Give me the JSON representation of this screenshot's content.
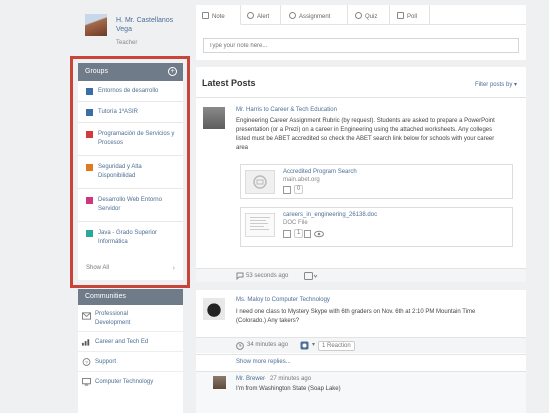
{
  "profile": {
    "name_line1": "H. Mr. Castellanos",
    "name_line2": "Vega",
    "role": "Teacher"
  },
  "groups": {
    "title": "Groups",
    "items": [
      {
        "label_1": "Entornos de desarrollo",
        "label_2": "",
        "color": "#3a6ea5"
      },
      {
        "label_1": "Tutoría 1ºASIR",
        "label_2": "",
        "color": "#3a6ea5"
      },
      {
        "label_1": "Programación de Servicios y",
        "label_2": "Procesos",
        "color": "#d23b3b"
      },
      {
        "label_1": "Seguridad y Alta",
        "label_2": "Disponibilidad",
        "color": "#e07a1e"
      },
      {
        "label_1": "Desarrollo Web Entorno",
        "label_2": "Servidor",
        "color": "#d0367a"
      },
      {
        "label_1": "Java - Grado Superior",
        "label_2": "Informática",
        "color": "#2aa89a"
      }
    ],
    "show_all": "Show All"
  },
  "communities": {
    "title": "Communities",
    "items": [
      {
        "label_1": "Professional",
        "label_2": "Development",
        "icon": "envelope-icon"
      },
      {
        "label_1": "Career and Tech Ed",
        "label_2": "",
        "icon": "bar-chart-icon"
      },
      {
        "label_1": "Support",
        "label_2": "",
        "icon": "help-icon"
      },
      {
        "label_1": "Computer Technology",
        "label_2": "",
        "icon": "monitor-icon"
      }
    ]
  },
  "composer": {
    "tabs": [
      "Note",
      "Alert",
      "Assignment",
      "Quiz",
      "Poll"
    ],
    "placeholder": "Type your note here..."
  },
  "feed": {
    "title": "Latest Posts",
    "filter": "Filter posts by ▾",
    "post1": {
      "author": "Mr. Harris to Career & Tech Education",
      "body": [
        "Engineering Career Assignment Rubric (by request). Students are asked to prepare a PowerPoint",
        "presentation (or a Prezi) on a career in Engineering using the attached worksheets. Any colleges",
        "listed must be ABET accredited so check the ABET search link below for schools with your career",
        "area"
      ],
      "link_title": "Accredited Program Search",
      "link_url": "main.abet.org",
      "link_count": "0",
      "file_name": "careers_in_engineering_26138.doc",
      "file_type": "DOC File",
      "file_count": "1",
      "time": "53 seconds ago"
    },
    "post2": {
      "author": "Ms. Maloy to Computer Technology",
      "body": [
        "I need one class to Mystery Skype with 6th graders on Nov. 6th at 2:10 PM Mountain Time",
        "(Colorado.) Any takers?"
      ],
      "time": "34 minutes ago",
      "reactions": "1 Reaction",
      "show_more": "Show more replies...",
      "reply_author": "Mr. Brewer",
      "reply_time": "27 minutes ago",
      "reply_body": "I'm from Washington State (Soap Lake)"
    }
  }
}
